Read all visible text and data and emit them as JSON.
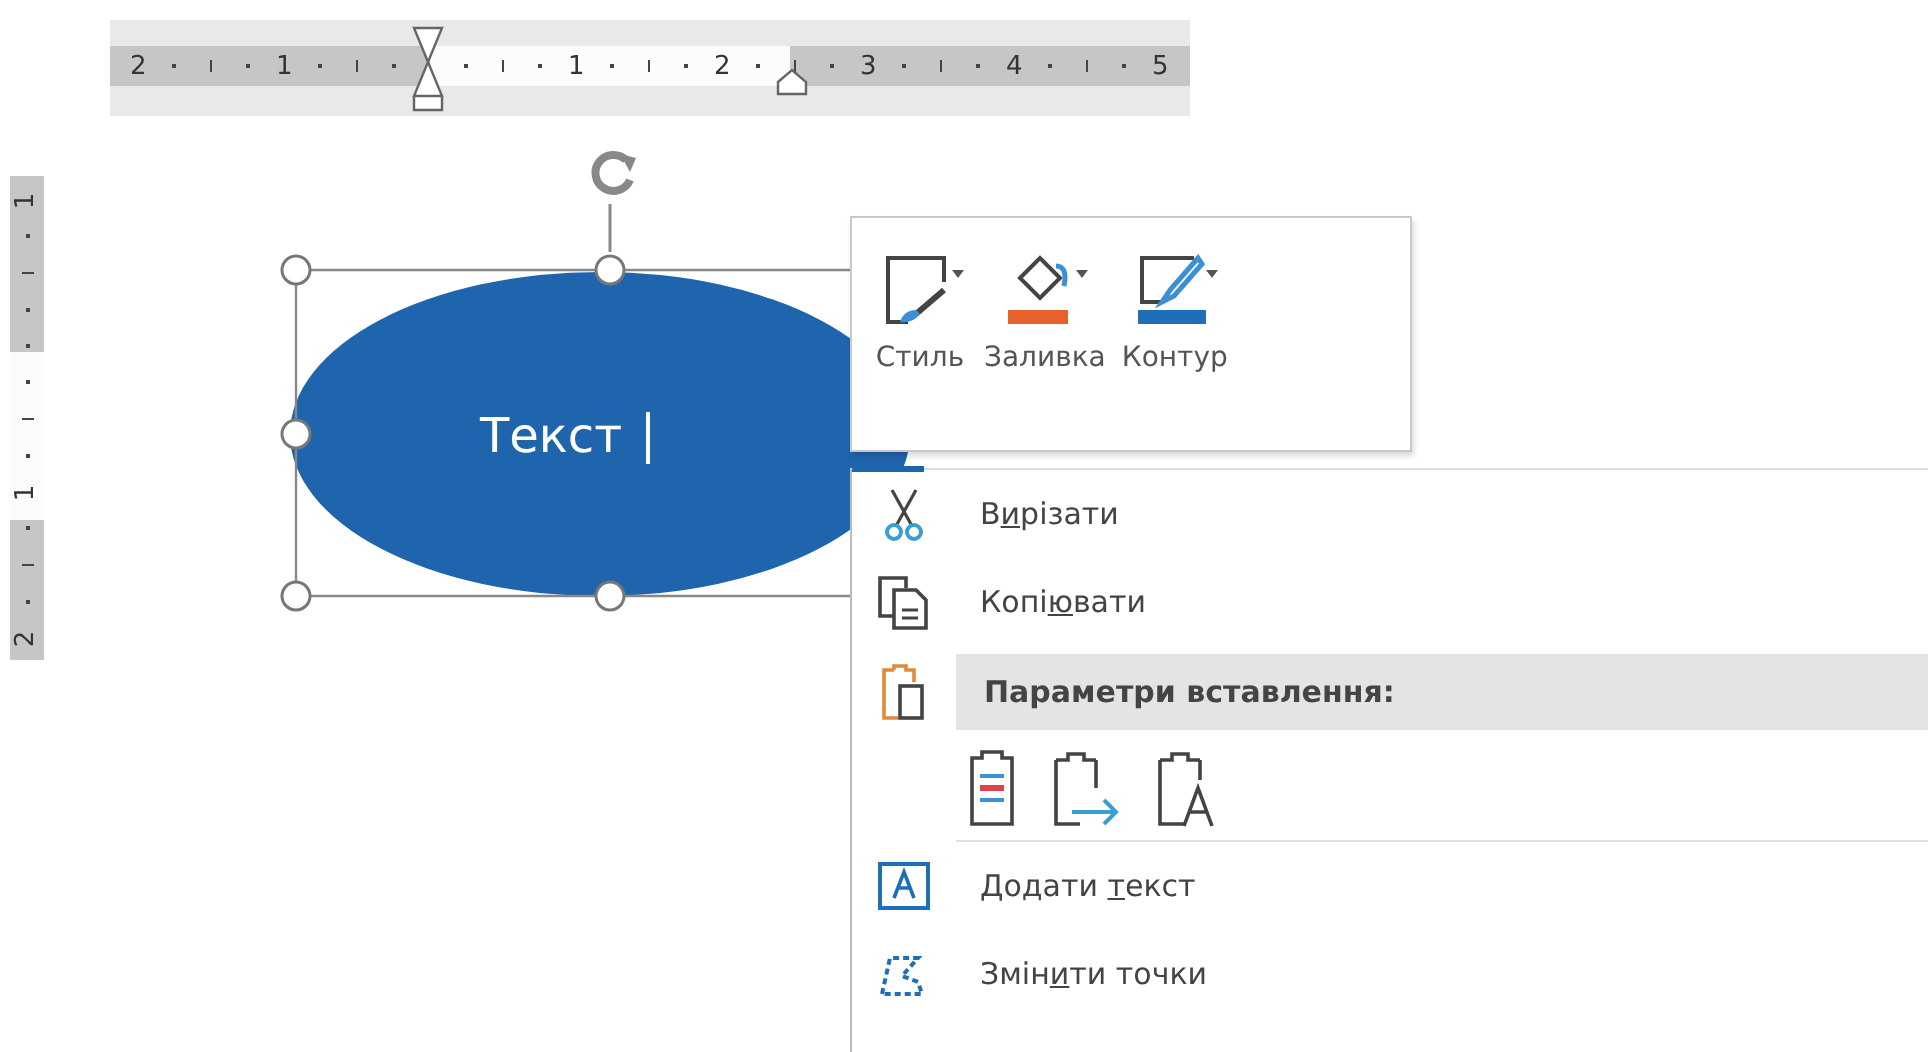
{
  "ruler": {
    "left_labels": [
      "2",
      "1"
    ],
    "right_labels": [
      "1",
      "2",
      "3",
      "4",
      "5"
    ]
  },
  "vertical_ruler": {
    "above_labels": [
      "1"
    ],
    "below_labels": [
      "1",
      "2"
    ]
  },
  "shape": {
    "text": "Текст"
  },
  "mini_toolbar": {
    "buttons": [
      {
        "label": "Стиль"
      },
      {
        "label": "Заливка"
      },
      {
        "label": "Контур"
      }
    ]
  },
  "context_menu": {
    "items": [
      {
        "kind": "command",
        "label_parts": [
          "В",
          "и",
          "різати"
        ]
      },
      {
        "kind": "command",
        "label_parts": [
          "Копі",
          "ю",
          "вати"
        ]
      },
      {
        "kind": "header",
        "label": "Параметри вставлення:"
      },
      {
        "kind": "paste_options"
      },
      {
        "kind": "command",
        "label_parts": [
          "Додати ",
          "т",
          "екст"
        ]
      },
      {
        "kind": "command",
        "label_parts": [
          "Змін",
          "и",
          "ти точки"
        ]
      }
    ]
  }
}
